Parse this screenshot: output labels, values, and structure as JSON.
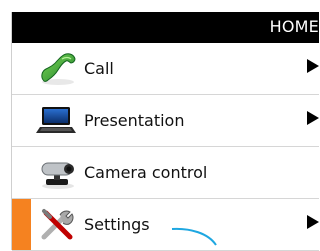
{
  "header": {
    "title": "HOME"
  },
  "menu": [
    {
      "label": "Call",
      "icon": "phone-icon",
      "has_submenu": true
    },
    {
      "label": "Presentation",
      "icon": "laptop-icon",
      "has_submenu": true
    },
    {
      "label": "Camera control",
      "icon": "camera-icon",
      "has_submenu": false
    },
    {
      "label": "Settings",
      "icon": "tools-icon",
      "has_submenu": true,
      "selected": true
    }
  ],
  "colors": {
    "header_bg": "#000000",
    "accent_selected": "#f58220",
    "annotation": "#1ea7e1"
  }
}
